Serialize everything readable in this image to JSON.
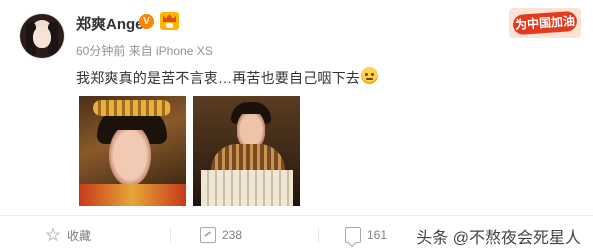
{
  "post": {
    "username": "郑爽Angel",
    "verified_badge": "V",
    "meta": "60分钟前 来自 iPhone XS",
    "text": "我郑爽真的是苦不言衷…再苦也要自己咽下去",
    "emoji_icon": "blush-emoji-icon",
    "images": [
      "photo-1",
      "photo-2"
    ]
  },
  "promo": {
    "label": "为中国加油"
  },
  "actions": {
    "favorite_label": "收藏",
    "repost_count": "238",
    "comment_count": "161"
  },
  "watermark": "头条 @不熬夜会死星人",
  "colors": {
    "verified": "#ff8200",
    "vip": "#ffb400",
    "promo_red": "#e23a1f",
    "meta_gray": "#939393"
  }
}
